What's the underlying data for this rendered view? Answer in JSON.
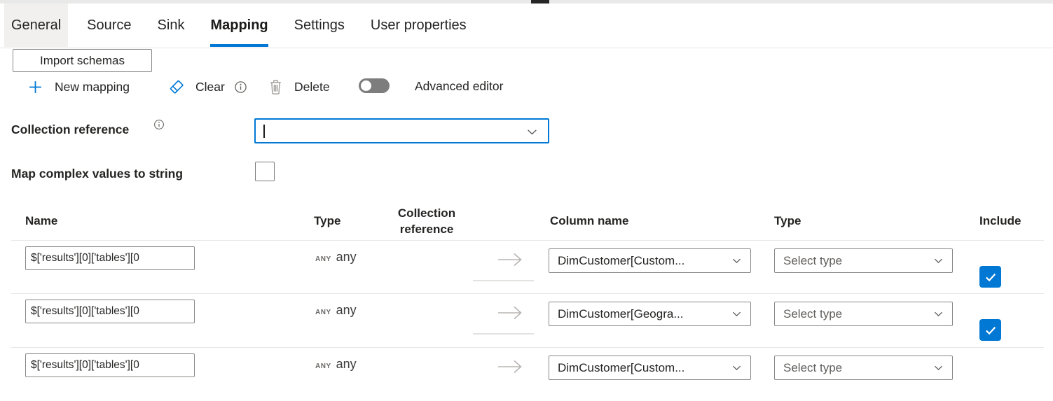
{
  "tabs": [
    {
      "label": "General",
      "selected": false
    },
    {
      "label": "Source",
      "selected": false
    },
    {
      "label": "Sink",
      "selected": false
    },
    {
      "label": "Mapping",
      "selected": true
    },
    {
      "label": "Settings",
      "selected": false
    },
    {
      "label": "User properties",
      "selected": false
    }
  ],
  "toolbar": {
    "import_schemas": "Import schemas",
    "new_mapping": "New mapping",
    "clear": "Clear",
    "delete": "Delete",
    "advanced_editor": "Advanced editor",
    "advanced_editor_on": false
  },
  "fields": {
    "collection_reference": {
      "label": "Collection reference",
      "value": "",
      "focused": true
    },
    "map_complex": {
      "label": "Map complex values to string",
      "checked": false
    }
  },
  "table": {
    "headers": {
      "name": "Name",
      "type": "Type",
      "collection_reference_line1": "Collection",
      "collection_reference_line2": "reference",
      "column_name": "Column name",
      "type2": "Type",
      "include": "Include"
    },
    "rows": [
      {
        "name": "$['results'][0]['tables'][0",
        "type_abbr": "ANY",
        "type": "any",
        "column_name": "DimCustomer[Custom...",
        "type_select": "Select type",
        "include": true
      },
      {
        "name": "$['results'][0]['tables'][0",
        "type_abbr": "ANY",
        "type": "any",
        "column_name": "DimCustomer[Geogra...",
        "type_select": "Select type",
        "include": true
      },
      {
        "name": "$['results'][0]['tables'][0",
        "type_abbr": "ANY",
        "type": "any",
        "column_name": "DimCustomer[Custom...",
        "type_select": "Select type",
        "include": null
      }
    ]
  },
  "icons": {
    "new_mapping": "plus-icon",
    "clear": "eraser-icon",
    "clear_info": "info-icon",
    "delete": "trash-icon",
    "collection_reference_info": "info-icon",
    "combobox_chevron": "chevron-down-icon",
    "dropdown_chevron": "chevron-down-icon",
    "mapping_arrow": "arrow-right-icon",
    "include_check": "check-icon"
  },
  "colors": {
    "accent": "#0078d4",
    "checkbox_checked": "#0078d4",
    "toggle_off": "#7d7d7d",
    "selected_tab_underline": "#0078d4",
    "general_tab_background": "#f1f0ef"
  }
}
